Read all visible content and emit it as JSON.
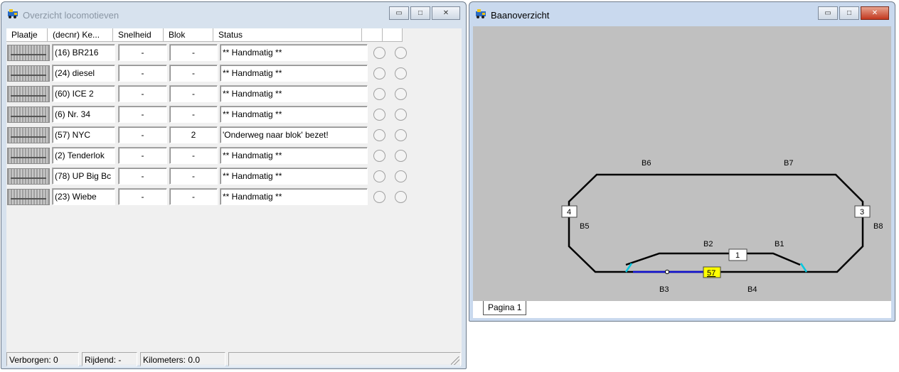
{
  "loco_window": {
    "title": "Overzicht locomotieven",
    "columns": [
      "Plaatje",
      "(decnr) Ke...",
      "Snelheid",
      "Blok",
      "Status",
      "",
      ""
    ],
    "rows": [
      {
        "name": "(16) BR216",
        "speed": "-",
        "block": "-",
        "status": "** Handmatig **"
      },
      {
        "name": "(24) diesel",
        "speed": "-",
        "block": "-",
        "status": "** Handmatig **"
      },
      {
        "name": "(60) ICE 2",
        "speed": "-",
        "block": "-",
        "status": "** Handmatig **"
      },
      {
        "name": "(6) Nr. 34",
        "speed": "-",
        "block": "-",
        "status": "** Handmatig **"
      },
      {
        "name": "(57) NYC",
        "speed": "-",
        "block": "2",
        "status": "'Onderweg naar blok' bezet!"
      },
      {
        "name": "(2) Tenderlok",
        "speed": "-",
        "block": "-",
        "status": "** Handmatig **"
      },
      {
        "name": "(78) UP Big Bc",
        "speed": "-",
        "block": "-",
        "status": "** Handmatig **"
      },
      {
        "name": "(23) Wiebe",
        "speed": "-",
        "block": "-",
        "status": "** Handmatig **"
      }
    ],
    "statusbar": {
      "hidden": "Verborgen: 0",
      "driving": "Rijdend: -",
      "kilometers": "Kilometers: 0.0"
    }
  },
  "track_window": {
    "title": "Baanoverzicht",
    "tab": "Pagina 1",
    "block_labels": {
      "b1": "B1",
      "b2": "B2",
      "b3": "B3",
      "b4": "B4",
      "b5": "B5",
      "b6": "B6",
      "b7": "B7",
      "b8": "B8"
    },
    "markers": {
      "m4": "4",
      "m3": "3",
      "m1": "1",
      "m57": "57"
    },
    "colors": {
      "track": "#000000",
      "occupied_track": "#1010d0",
      "turnout": "#00c8e0",
      "loco_marker": "#ffff00",
      "canvas": "#c0c0c0"
    }
  },
  "window_buttons": {
    "minimize": "▭",
    "maximize": "□",
    "close": "✕"
  }
}
